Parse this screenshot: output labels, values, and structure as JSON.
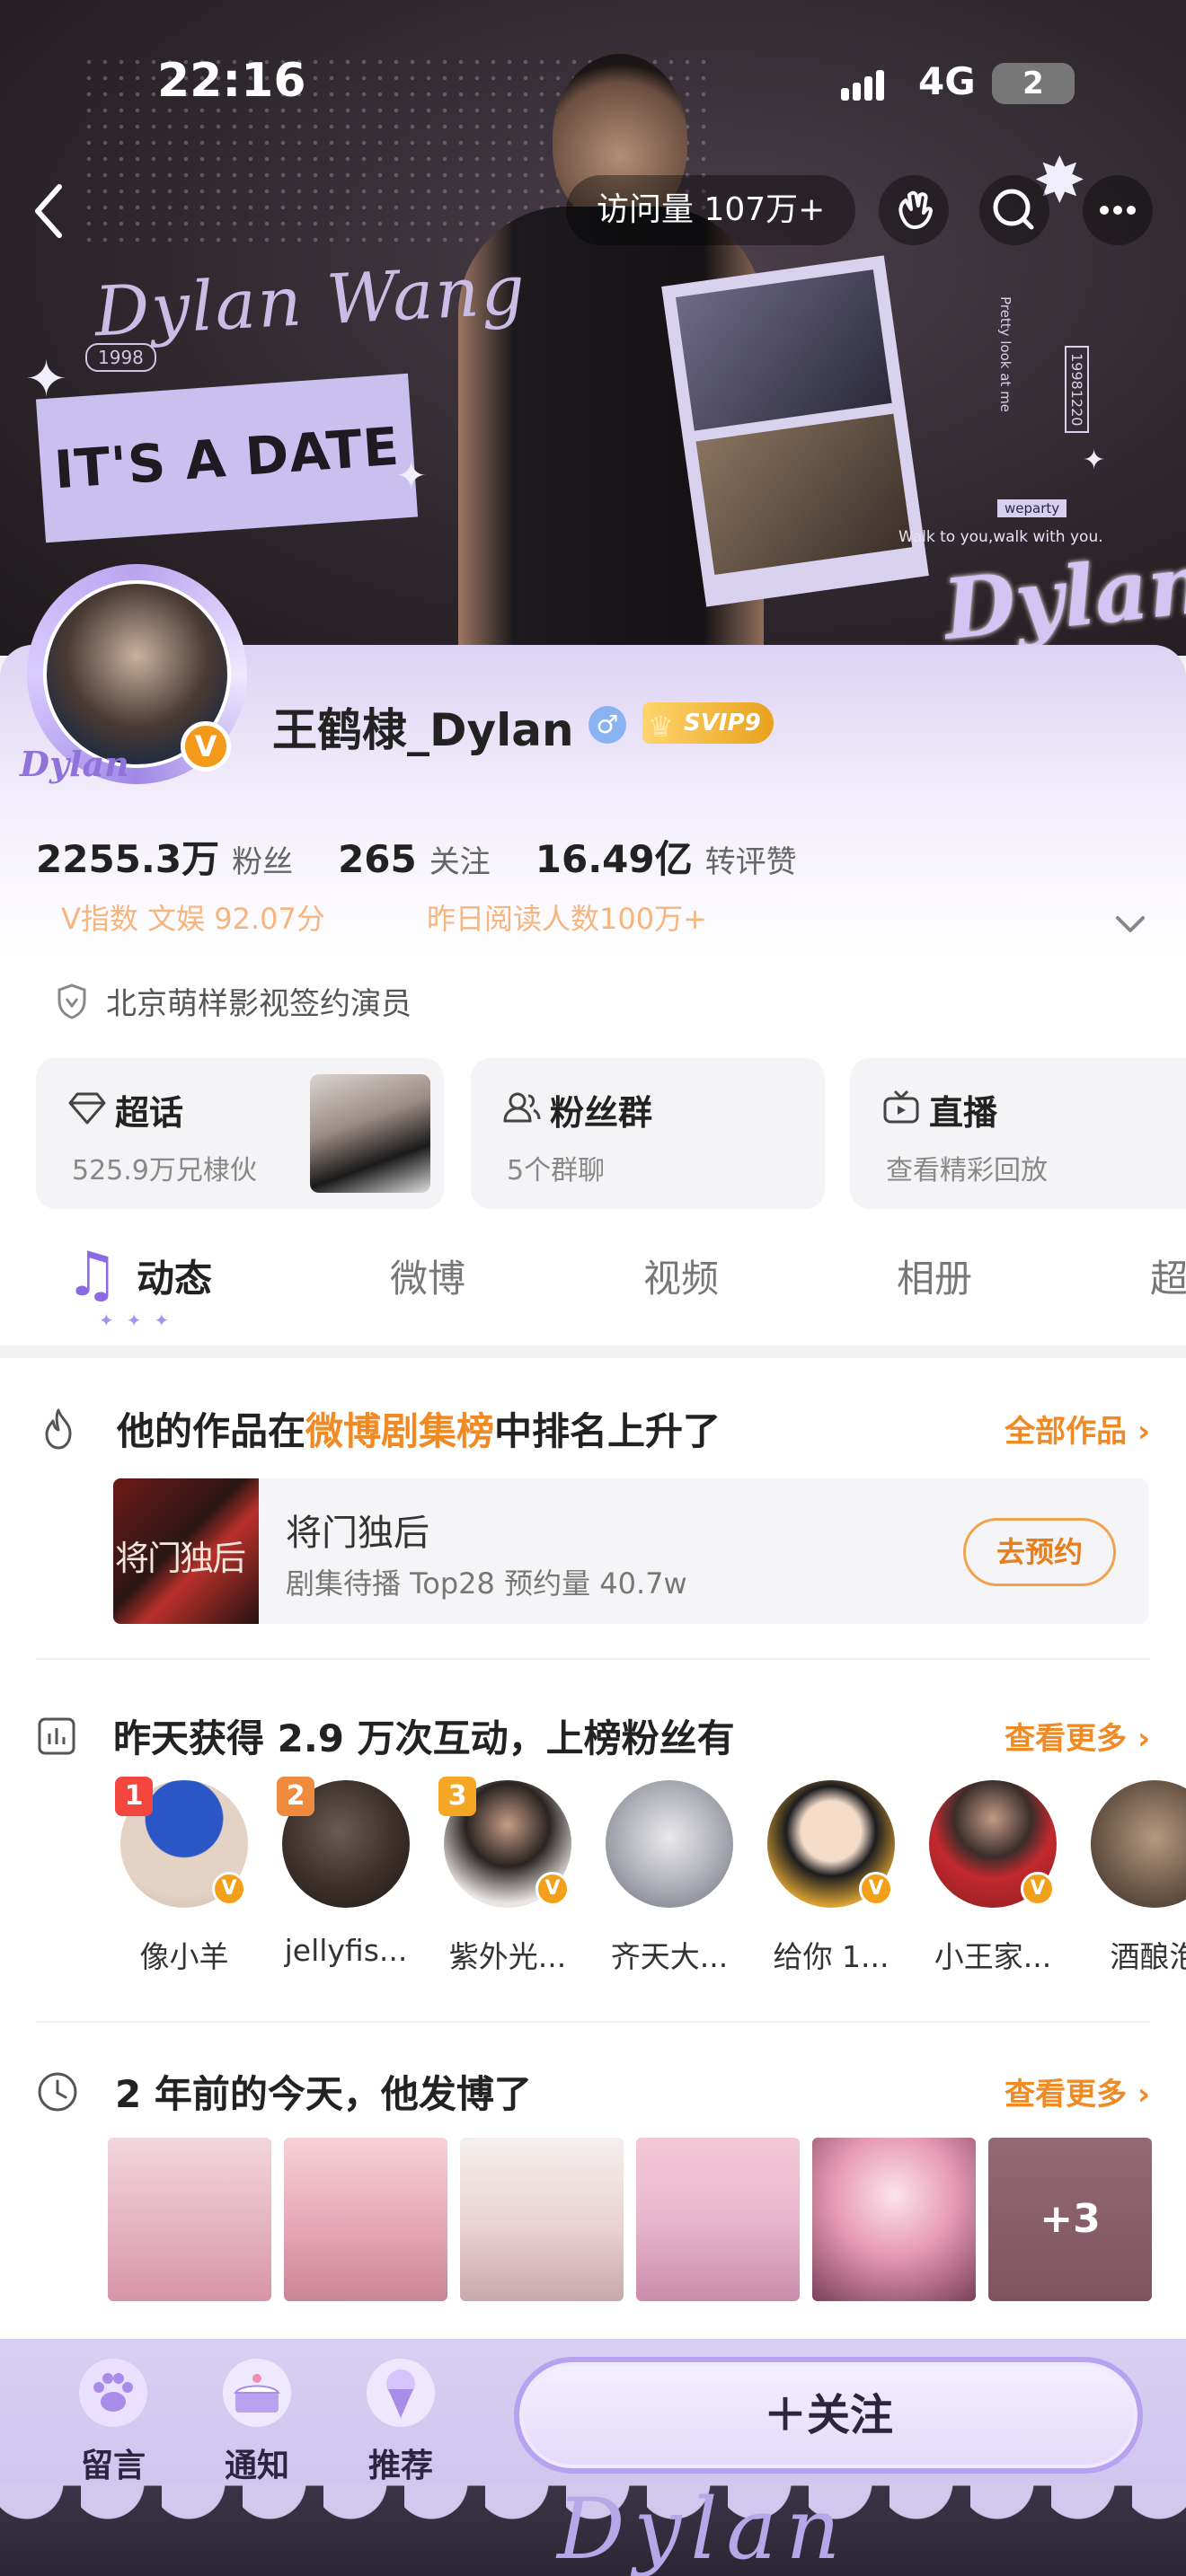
{
  "status_bar": {
    "time": "22:16",
    "network": "4G",
    "battery": "2"
  },
  "banner": {
    "script_name": "Dylan Wang",
    "year_pill": "1998",
    "headline": "IT'S A DATE",
    "caption_a": "Walk to you,walk with you.",
    "caption_b": "weparty",
    "id_tag": "19981220",
    "vertical_text": "Pretty look at me",
    "big_name": "Dylan"
  },
  "nav": {
    "visits": "访问量 107万+"
  },
  "profile": {
    "username": "王鹤棣_Dylan",
    "gender_symbol": "♂",
    "vip_label": "SVIP9",
    "avatar_tag": "Dylan",
    "verify_badge": "V",
    "stats": [
      {
        "num": "2255.3万",
        "label": "粉丝"
      },
      {
        "num": "265",
        "label": "关注"
      },
      {
        "num": "16.49亿",
        "label": "转评赞"
      }
    ],
    "v_index": "V指数  文娱 92.07分",
    "yesterday_reads": "昨日阅读人数100万+",
    "certification": "北京萌样影视签约演员"
  },
  "cards": [
    {
      "title": "超话",
      "sub": "525.9万兄棣伙"
    },
    {
      "title": "粉丝群",
      "sub": "5个群聊"
    },
    {
      "title": "直播",
      "sub": "查看精彩回放"
    }
  ],
  "tabs": [
    "动态",
    "微博",
    "视频",
    "相册",
    "超"
  ],
  "sections": {
    "drama": {
      "title_prefix": "他的作品在",
      "title_highlight": "微博剧集榜",
      "title_suffix": "中排名上升了",
      "more": "全部作品 ›",
      "poster_text": "将门独后",
      "name": "将门独后",
      "info": "剧集待播 Top28  预约量 40.7w",
      "button": "去预约"
    },
    "interactions": {
      "title": "昨天获得 2.9 万次互动，上榜粉丝有",
      "more": "查看更多 ›",
      "fans": [
        {
          "name": "像小羊",
          "rank": "1",
          "rank_color": "#f2463e",
          "verified": true
        },
        {
          "name": "jellyfis...",
          "rank": "2",
          "rank_color": "#f08a3c",
          "verified": false
        },
        {
          "name": "紫外光...",
          "rank": "3",
          "rank_color": "#f5a623",
          "verified": true
        },
        {
          "name": "齐天大...",
          "rank": "",
          "rank_color": "",
          "verified": false
        },
        {
          "name": "给你 1...",
          "rank": "",
          "rank_color": "",
          "verified": true
        },
        {
          "name": "小王家...",
          "rank": "",
          "rank_color": "",
          "verified": true
        },
        {
          "name": "酒酿泡",
          "rank": "",
          "rank_color": "",
          "verified": false
        }
      ]
    },
    "memory": {
      "title": "2 年前的今天，他发博了",
      "more": "查看更多 ›",
      "extra_count": "+3"
    }
  },
  "bottom_bar": {
    "items": [
      "留言",
      "通知",
      "推荐"
    ],
    "follow": "＋关注",
    "script": "Dylan"
  },
  "colors": {
    "accent": "#f08a24",
    "brand_purple": "#8b6ae3",
    "vip_gold": "#e9a11c"
  }
}
